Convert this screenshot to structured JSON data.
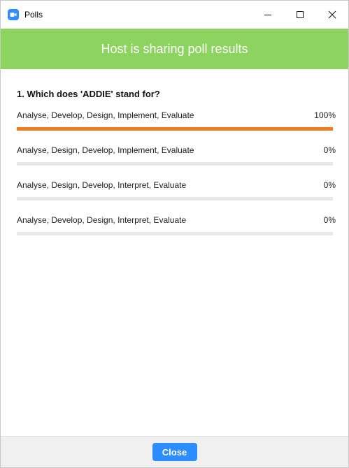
{
  "window": {
    "title": "Polls",
    "app_icon": "zoom-camera-icon",
    "controls": [
      "minimize-icon",
      "maximize-icon",
      "close-icon"
    ]
  },
  "banner": {
    "text": "Host is sharing poll results",
    "color": "#8dd35f"
  },
  "poll": {
    "question": "1. Which does 'ADDIE' stand for?",
    "options": [
      {
        "label": "Analyse, Develop, Design, Implement, Evaluate",
        "percent_text": "100%",
        "percent": 100
      },
      {
        "label": "Analyse, Design, Develop, Implement, Evaluate",
        "percent_text": "0%",
        "percent": 0
      },
      {
        "label": "Analyse, Design, Develop, Interpret, Evaluate",
        "percent_text": "0%",
        "percent": 0
      },
      {
        "label": "Analyse, Develop, Design, Interpret, Evaluate",
        "percent_text": "0%",
        "percent": 0
      }
    ],
    "bar_color": "#f27a1a"
  },
  "footer": {
    "close_label": "Close",
    "button_color": "#2d8cff"
  }
}
